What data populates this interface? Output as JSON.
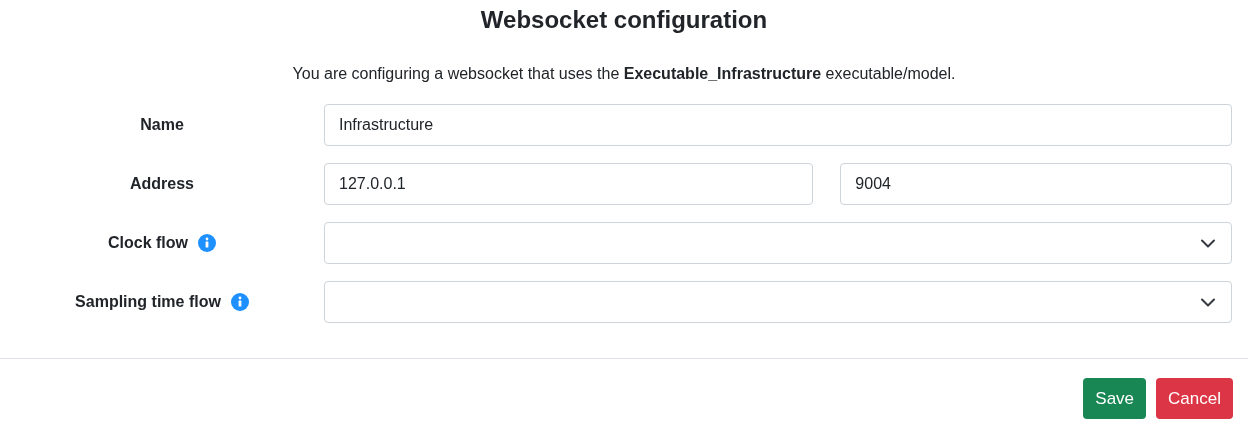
{
  "title": "Websocket configuration",
  "intro": "You are configuring a websocket that uses the **Executable_Infrastructure** executable/model.",
  "fields": [
    {
      "label": "Name",
      "info": false,
      "inputs": [
        {
          "kind": "text",
          "value": "Infrastructure"
        }
      ]
    },
    {
      "label": "Address",
      "info": false,
      "inputs": [
        {
          "kind": "text",
          "value": "127.0.0.1"
        },
        {
          "kind": "text",
          "value": "9004"
        }
      ]
    },
    {
      "label": "Clock flow",
      "info": true,
      "inputs": [
        {
          "kind": "select"
        }
      ]
    },
    {
      "label": "Sampling time flow",
      "info": true,
      "inputs": [
        {
          "kind": "select"
        }
      ]
    }
  ],
  "buttons": [
    {
      "label": "Save",
      "kind": "primary"
    },
    {
      "label": "Cancel",
      "kind": "danger"
    }
  ]
}
